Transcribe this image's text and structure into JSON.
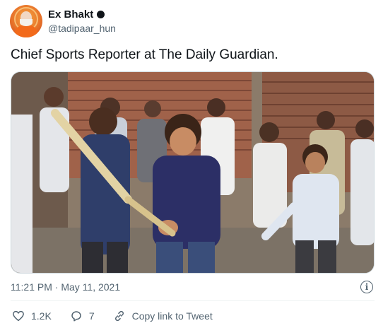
{
  "author": {
    "display_name": "Ex Bhakt",
    "handle": "@tadipaar_hun",
    "avatar_icon": "profile-photo-icon",
    "badge_icon": "account-badge-icon"
  },
  "tweet": {
    "text": "Chief Sports Reporter at The Daily Guardian.",
    "timestamp": "11:21 PM · May 11, 2021"
  },
  "media": {
    "type": "photo",
    "alt": ""
  },
  "actions": {
    "like_count": "1.2K",
    "reply_count": "7",
    "copy_link_label": "Copy link to Tweet",
    "info_icon_glyph": "i"
  },
  "colors": {
    "text_primary": "#0f1419",
    "text_secondary": "#536471",
    "divider": "#eff3f4",
    "border": "#cfd9de"
  }
}
